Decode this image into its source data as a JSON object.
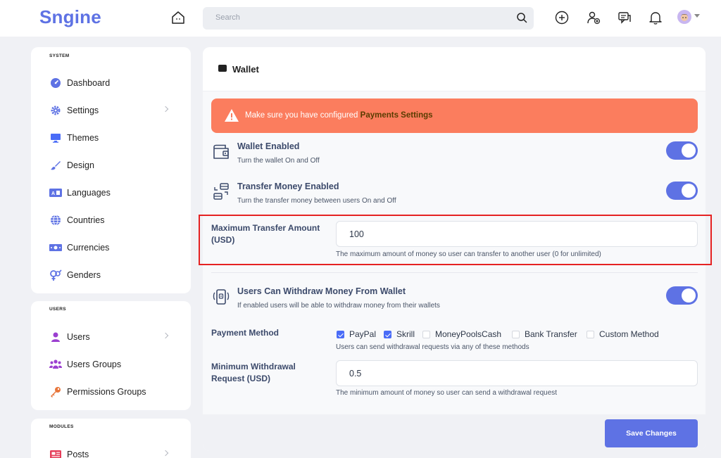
{
  "header": {
    "logo": "Sngine",
    "search_placeholder": "Search"
  },
  "sidebar": {
    "system_heading": "SYSTEM",
    "system_items": [
      {
        "label": "Dashboard"
      },
      {
        "label": "Settings"
      },
      {
        "label": "Themes"
      },
      {
        "label": "Design"
      },
      {
        "label": "Languages"
      },
      {
        "label": "Countries"
      },
      {
        "label": "Currencies"
      },
      {
        "label": "Genders"
      }
    ],
    "users_heading": "USERS",
    "users_items": [
      {
        "label": "Users"
      },
      {
        "label": "Users Groups"
      },
      {
        "label": "Permissions Groups"
      }
    ],
    "modules_heading": "MODULES",
    "modules_items": [
      {
        "label": "Posts"
      }
    ]
  },
  "main": {
    "title": "Wallet",
    "alert": {
      "text": "Make sure you have configured ",
      "link": "Payments Settings"
    },
    "wallet_enabled": {
      "title": "Wallet Enabled",
      "subtitle": "Turn the wallet On and Off",
      "on": true
    },
    "transfer_enabled": {
      "title": "Transfer Money Enabled",
      "subtitle": "Turn the transfer money between users On and Off",
      "on": true
    },
    "max_transfer": {
      "label_line1": "Maximum Transfer Amount",
      "label_line2": "(USD)",
      "value": "100",
      "help": "The maximum amount of money so user can transfer to another user (0 for unlimited)"
    },
    "withdraw": {
      "title": "Users Can Withdraw Money From Wallet",
      "subtitle": "If enabled users will be able to withdraw money from their wallets",
      "on": true
    },
    "payment_method": {
      "label": "Payment Method",
      "options": [
        {
          "label": "PayPal",
          "checked": true
        },
        {
          "label": "Skrill",
          "checked": true
        },
        {
          "label": "MoneyPoolsCash",
          "checked": false
        },
        {
          "label": "Bank Transfer",
          "checked": false
        },
        {
          "label": "Custom Method",
          "checked": false
        }
      ],
      "help": "Users can send withdrawal requests via any of these methods"
    },
    "min_withdrawal": {
      "label_line1": "Minimum Withdrawal",
      "label_line2": "Request (USD)",
      "value": "0.5",
      "help": "The minimum amount of money so user can send a withdrawal request"
    },
    "save_label": "Save Changes"
  },
  "colors": {
    "accent": "#5e72e4",
    "alert": "#fb7d5e",
    "highlight": "#e52222"
  }
}
